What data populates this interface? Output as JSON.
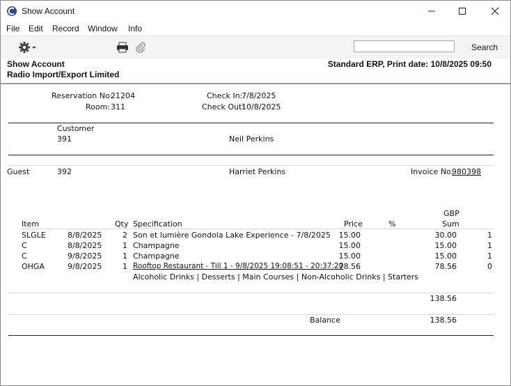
{
  "window": {
    "title": "Show Account",
    "minimize": "—",
    "maximize": "☐",
    "close": "✕"
  },
  "menu": [
    "File",
    "Edit",
    "Record",
    "Window",
    "Info"
  ],
  "toolbar": {
    "search_placeholder": "",
    "search_label": "Search"
  },
  "header": {
    "title": "Show Account",
    "company": "Radio Import/Export Limited",
    "right": "Standard ERP, Print date:  10/8/2025 09:50"
  },
  "reservation": {
    "res_label": "Reservation No:",
    "res_value": "21204",
    "room_label": "Room:",
    "room_value": "311",
    "checkin_label": "Check In:",
    "checkin_value": "7/8/2025",
    "checkout_label": "Check Out:",
    "checkout_value": "10/8/2025"
  },
  "customer": {
    "label": "Customer",
    "code": "391",
    "name": "Neil Perkins"
  },
  "guest": {
    "label": "Guest",
    "code": "392",
    "name": "Harriet Perkins",
    "invoice_label": "Invoice No.",
    "invoice_value": "980398"
  },
  "columns": {
    "item": "Item",
    "qty": "Qty",
    "spec": "Specification",
    "price": "Price",
    "pct": "%",
    "currency": "GBP",
    "sum": "Sum"
  },
  "rows": [
    {
      "item": "SLGLE",
      "date": "8/8/2025",
      "qty": "2",
      "spec": "Son et lumière Gondola Lake Experience - 7/8/2025",
      "price": "15.00",
      "sum": "30.00",
      "flag": "1"
    },
    {
      "item": "C",
      "date": "8/8/2025",
      "qty": "1",
      "spec": "Champagne",
      "price": "15.00",
      "sum": "15.00",
      "flag": "1"
    },
    {
      "item": "C",
      "date": "9/8/2025",
      "qty": "1",
      "spec": "Champagne",
      "price": "15.00",
      "sum": "15.00",
      "flag": "1"
    },
    {
      "item": "OHGA",
      "date": "9/8/2025",
      "qty": "1",
      "spec": "Rooftop Restaurant - Till 1 - 9/8/2025 19:08:51 - 20:37:20",
      "price": "78.56",
      "sum": "78.56",
      "flag": "0"
    }
  ],
  "row_note": "Alcoholic Drinks | Desserts | Main Courses | Non-Alcoholic Drinks | Starters",
  "totals": {
    "total": "138.56",
    "balance_label": "Balance",
    "balance": "138.56"
  }
}
